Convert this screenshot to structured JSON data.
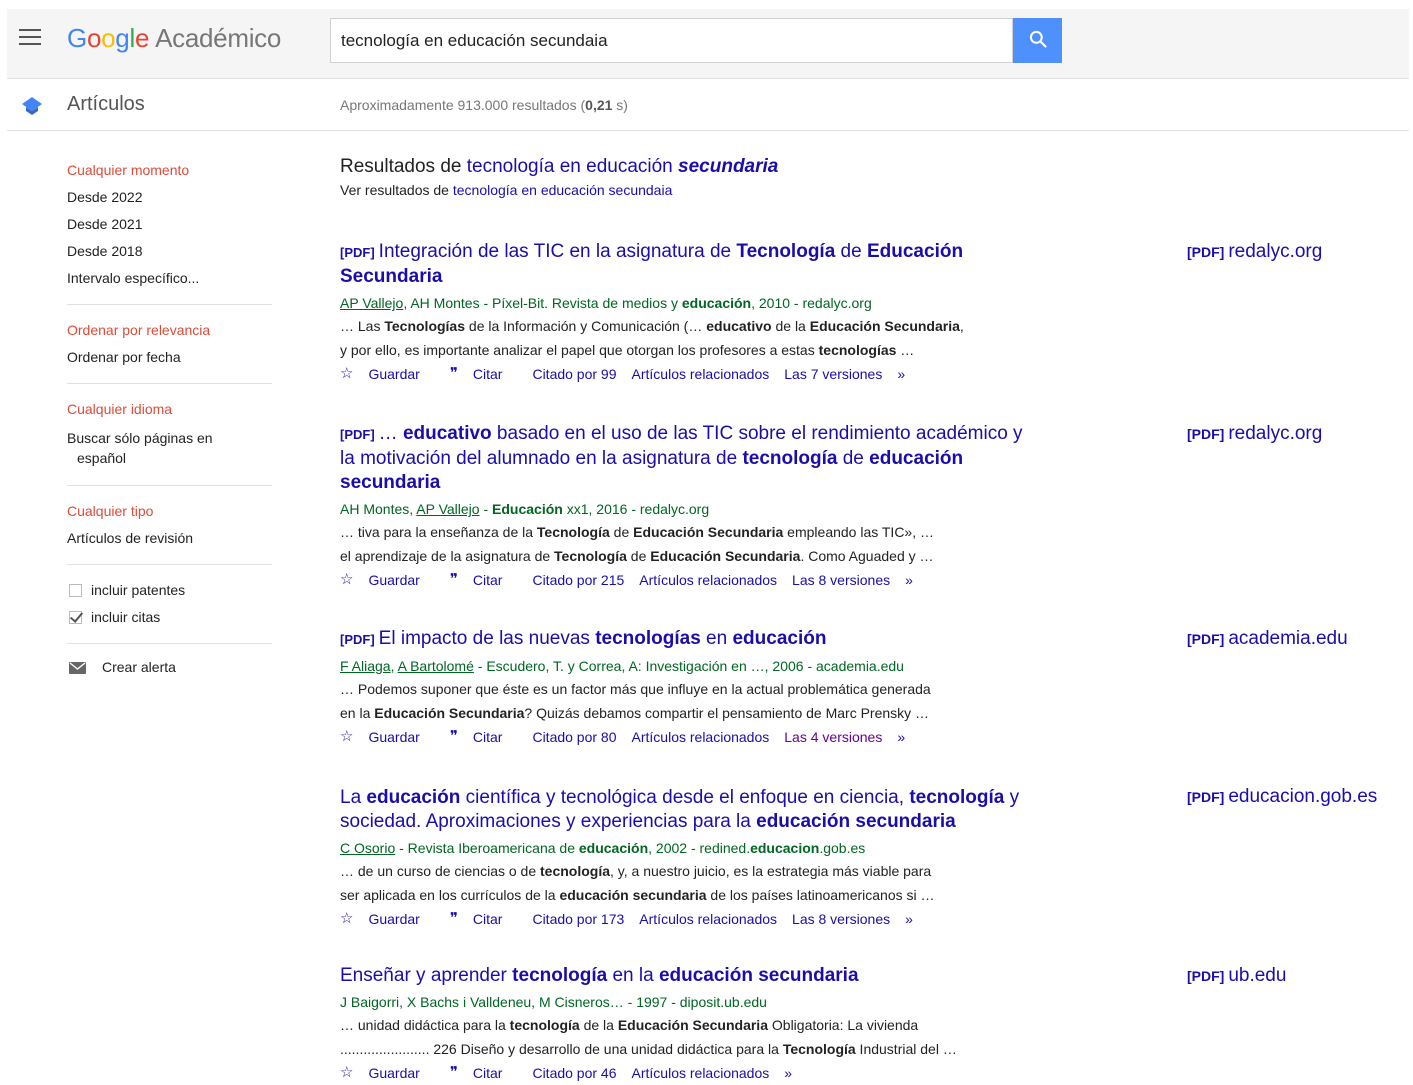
{
  "header": {
    "logo_google": "Google",
    "logo_product": "Académico",
    "search_value": "tecnología en educación secundaia"
  },
  "subheader": {
    "section": "Artículos",
    "count_prefix": "Aproximadamente 913.000 resultados (",
    "count_time": "0,21",
    "count_suffix": " s)"
  },
  "sidebar": {
    "time": [
      "Cualquier momento",
      "Desde 2022",
      "Desde 2021",
      "Desde 2018",
      "Intervalo específico..."
    ],
    "sort": [
      "Ordenar por relevancia",
      "Ordenar por fecha"
    ],
    "lang": [
      "Cualquier idioma",
      "Buscar sólo páginas en",
      "español"
    ],
    "type": [
      "Cualquier tipo",
      "Artículos de revisión"
    ],
    "patents": "incluir patentes",
    "citations": "incluir citas",
    "alert": "Crear alerta"
  },
  "correction": {
    "prefix": "Resultados de ",
    "corrected": "tecnología en educación ",
    "corrected_bold": "secundaria",
    "seealso_prefix": "Ver resultados de ",
    "seealso_link": "tecnología en educación secundaia"
  },
  "actions": {
    "save": "Guardar",
    "cite": "Citar",
    "related": "Artículos relacionados",
    "more": "»"
  },
  "results": [
    {
      "tag": "[PDF]",
      "title_line1": "Integración de las TIC en la asignatura de Tecnología de Educación",
      "title_line2": "Secundaria",
      "meta": "AP Vallejo, AH Montes - Píxel-Bit. Revista de medios y educación, 2010 - redalyc.org",
      "snippet1": "… Las Tecnologías de la Información y Comunicación (… educativo de la Educación Secundaria,",
      "snippet2": "y por ello, es importante analizar el papel que otorgan los profesores a estas tecnologías …",
      "cited": "Citado por 99",
      "versions": "Las 7 versiones",
      "side_tag": "[PDF]",
      "side_domain": "redalyc.org"
    },
    {
      "tag": "[PDF]",
      "title_line1": "… educativo basado en el uso de las TIC sobre el rendimiento académico y",
      "title_line2": "la motivación del alumnado en la asignatura de tecnología de educación",
      "title_line3": "secundaria",
      "meta": "AH Montes, AP Vallejo - Educación xx1, 2016 - redalyc.org",
      "snippet1": "… tiva para la enseñanza de la Tecnología de Educación Secundaria empleando las TIC», …",
      "snippet2": "el aprendizaje de la asignatura de Tecnología de Educación Secundaria. Como Aguaded y …",
      "cited": "Citado por 215",
      "versions": "Las 8 versiones",
      "side_tag": "[PDF]",
      "side_domain": "redalyc.org"
    },
    {
      "tag": "[PDF]",
      "title_line1": "El impacto de las nuevas tecnologías en educación",
      "meta": "F Aliaga, A Bartolomé - Escudero, T. y Correa, A: Investigación en …, 2006 - academia.edu",
      "snippet1": "… Podemos suponer que éste es un factor más que influye en la actual problemática generada",
      "snippet2": "en la Educación Secundaria? Quizás debamos compartir el pensamiento de Marc Prensky …",
      "cited": "Citado por 80",
      "versions": "Las 4 versiones",
      "side_tag": "[PDF]",
      "side_domain": "academia.edu"
    },
    {
      "title_line1": "La educación científica y tecnológica desde el enfoque en ciencia, tecnología y",
      "title_line2": "sociedad. Aproximaciones y experiencias para la educación secundaria",
      "meta": "C Osorio - Revista Iberoamericana de educación, 2002 - redined.educacion.gob.es",
      "snippet1": "… de un curso de ciencias o de tecnología, y, a nuestro juicio, es la estrategia más viable para",
      "snippet2": "ser aplicada en los currículos de la educación secundaria de los países latinoamericanos si …",
      "cited": "Citado por 173",
      "versions": "Las 8 versiones",
      "side_tag": "[PDF]",
      "side_domain": "educacion.gob.es"
    },
    {
      "title_line1": "Enseñar y aprender tecnología en la educación secundaria",
      "meta": "J Baigorri, X Bachs i Valldeneu, M Cisneros… - 1997 - diposit.ub.edu",
      "snippet1": "… unidad didáctica para la tecnología de la Educación Secundaria Obligatoria: La vivienda",
      "snippet2": "....................... 226 Diseño y desarrollo de una unidad didáctica para la Tecnología Industrial del …",
      "cited": "Citado por 46",
      "side_tag": "[PDF]",
      "side_domain": "ub.edu"
    }
  ]
}
